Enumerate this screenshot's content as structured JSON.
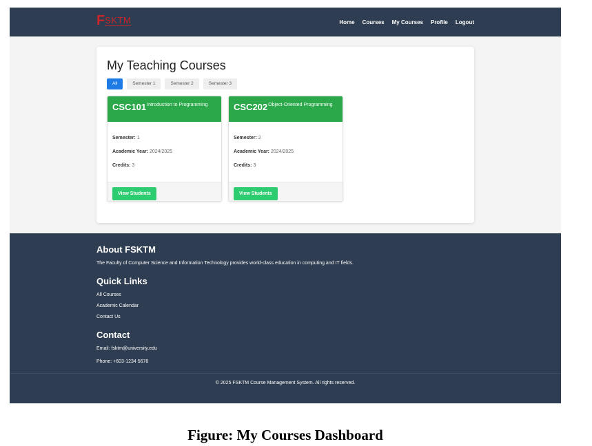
{
  "navbar": {
    "logo_letter": "F",
    "logo_rest": "SKTM",
    "links": [
      "Home",
      "Courses",
      "My Courses",
      "Profile",
      "Logout"
    ]
  },
  "main": {
    "title": "My Teaching Courses",
    "filters": [
      "All",
      "Semester 1",
      "Semester 2",
      "Semester 3"
    ],
    "active_filter": "All",
    "semester_label": "Semester:",
    "year_label": "Academic Year:",
    "credits_label": "Credits:",
    "view_button": "View Students",
    "courses": [
      {
        "code": "CSC101",
        "name": "Introduction to Programming",
        "semester": "1",
        "year": "2024/2025",
        "credits": "3"
      },
      {
        "code": "CSC202",
        "name": "Object-Oriented Programming",
        "semester": "2",
        "year": "2024/2025",
        "credits": "3"
      }
    ]
  },
  "footer": {
    "about_title": "About FSKTM",
    "about_text": "The Faculty of Computer Science and Information Technology provides world-class education in computing and IT fields.",
    "links_title": "Quick Links",
    "links": [
      "All Courses",
      "Academic Calendar",
      "Contact Us"
    ],
    "contact_title": "Contact",
    "email": "Email: fsktm@university.edu",
    "phone": "Phone: +603-1234 5678",
    "copyright": "© 2025 FSKTM Course Management System. All rights reserved."
  },
  "caption": "Figure: My Courses Dashboard",
  "colors": {
    "navbar": "#2e3d51",
    "accent_blue": "#1e7be6",
    "card_header_green": "#2aa84a",
    "button_green": "#2ecc71",
    "logo_red": "#c8262b"
  }
}
